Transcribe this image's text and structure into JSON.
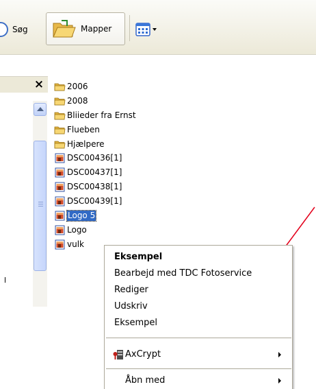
{
  "toolbar": {
    "search_label": "Søg",
    "folders_label": "Mapper",
    "views_icon": "views-grid-icon"
  },
  "pane": {
    "close_glyph": "×"
  },
  "files": [
    {
      "name": "2006",
      "icon": "folder-icon"
    },
    {
      "name": "2008",
      "icon": "folder-icon"
    },
    {
      "name": "Bliieder fra Ernst",
      "icon": "folder-icon"
    },
    {
      "name": "Flueben",
      "icon": "folder-icon"
    },
    {
      "name": "Hjælpere",
      "icon": "folder-icon"
    },
    {
      "name": "DSC00436[1]",
      "icon": "image-file-icon"
    },
    {
      "name": "DSC00437[1]",
      "icon": "image-file-icon"
    },
    {
      "name": "DSC00438[1]",
      "icon": "image-file-icon"
    },
    {
      "name": "DSC00439[1]",
      "icon": "image-file-icon"
    },
    {
      "name": "Logo 5",
      "icon": "image-file-icon",
      "selected": true
    },
    {
      "name": "Logo",
      "icon": "image-file-icon"
    },
    {
      "name": "vulk",
      "icon": "image-file-icon"
    }
  ],
  "context_menu": {
    "items": [
      {
        "label": "Eksempel",
        "bold": true
      },
      {
        "label": "Bearbejd med TDC Fotoservice"
      },
      {
        "label": "Rediger"
      },
      {
        "label": "Udskriv"
      },
      {
        "label": "Eksempel"
      },
      {
        "label": "AxCrypt",
        "submenu": true,
        "icon": "axcrypt-icon"
      },
      {
        "label": "Åbn med",
        "submenu": true
      }
    ]
  },
  "colors": {
    "selection": "#316ac5",
    "arrow": "#e3001b",
    "folder": "#f5d36b"
  }
}
